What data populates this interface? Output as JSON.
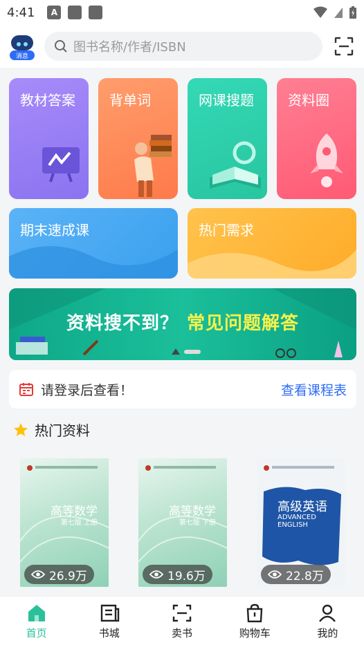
{
  "status": {
    "time": "4:41"
  },
  "header": {
    "message_badge": "消息",
    "search_placeholder": "图书名称/作者/ISBN"
  },
  "tiles": [
    {
      "label": "教材答案"
    },
    {
      "label": "背单词"
    },
    {
      "label": "网课搜题"
    },
    {
      "label": "资料圈"
    },
    {
      "label": "期末速成课"
    },
    {
      "label": "热门需求"
    }
  ],
  "banner": {
    "text_white": "资料搜不到？",
    "text_yellow": "常见问题解答"
  },
  "login": {
    "text": "请登录后查看！",
    "link": "查看课程表"
  },
  "section": {
    "title": "热门资料"
  },
  "books": [
    {
      "title": "高等数学",
      "subtitle": "第七版 上册",
      "views": "26.9万"
    },
    {
      "title": "高等数学",
      "subtitle": "第七版 下册",
      "views": "19.6万"
    },
    {
      "title": "高级英语",
      "subtitle": "ADVANCED ENGLISH",
      "views": "22.8万"
    }
  ],
  "tabbar": {
    "items": [
      {
        "label": "首页"
      },
      {
        "label": "书城"
      },
      {
        "label": "卖书"
      },
      {
        "label": "购物车"
      },
      {
        "label": "我的"
      }
    ]
  },
  "colors": {
    "accent": "#2bc09a",
    "link": "#2d6cf6"
  }
}
